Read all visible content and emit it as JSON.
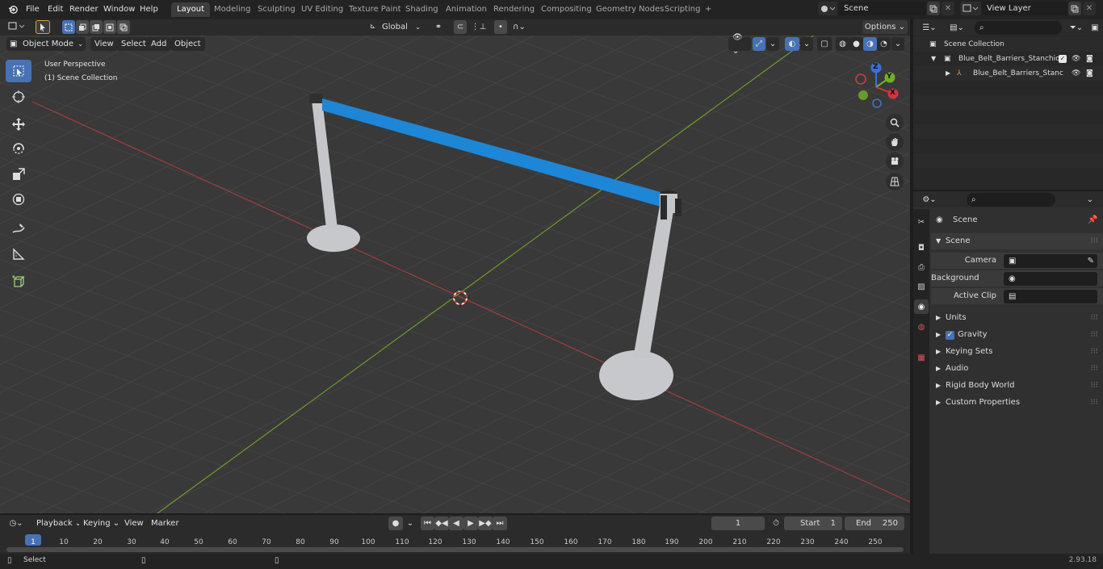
{
  "app": {
    "version": "2.93.18"
  },
  "menu": [
    "File",
    "Edit",
    "Render",
    "Window",
    "Help"
  ],
  "workspaces": [
    {
      "label": "Layout",
      "active": true
    },
    {
      "label": "Modeling",
      "active": false
    },
    {
      "label": "Sculpting",
      "active": false
    },
    {
      "label": "UV Editing",
      "active": false
    },
    {
      "label": "Texture Paint",
      "active": false
    },
    {
      "label": "Shading",
      "active": false
    },
    {
      "label": "Animation",
      "active": false
    },
    {
      "label": "Rendering",
      "active": false
    },
    {
      "label": "Compositing",
      "active": false
    },
    {
      "label": "Geometry Nodes",
      "active": false
    },
    {
      "label": "Scripting",
      "active": false
    }
  ],
  "scene_selector": {
    "value": "Scene"
  },
  "viewlayer_selector": {
    "value": "View Layer"
  },
  "tool_header": {
    "transform_orientation": "Global",
    "options_label": "Options"
  },
  "viewport_header": {
    "mode": "Object Mode",
    "menus": [
      "View",
      "Select",
      "Add",
      "Object"
    ]
  },
  "viewport": {
    "perspective_label": "User Perspective",
    "collection_label": "(1) Scene Collection",
    "gizmo": {
      "x": "X",
      "y": "Y",
      "z": "Z"
    },
    "colors": {
      "belt": "#1e86d6",
      "post": "#c4c6ca",
      "axis_x": "#b0393d",
      "axis_y": "#78a32a",
      "bg": "#393939"
    }
  },
  "outliner": {
    "items": [
      {
        "label": "Scene Collection"
      },
      {
        "label": "Blue_Belt_Barriers_Stanchion"
      },
      {
        "label": "Blue_Belt_Barriers_Stanc"
      }
    ]
  },
  "properties": {
    "context": "Scene",
    "panel": "Scene",
    "fields": [
      {
        "label": "Camera"
      },
      {
        "label": "Background Scene"
      },
      {
        "label": "Active Clip"
      }
    ],
    "subpanels": [
      "Units",
      "Gravity",
      "Keying Sets",
      "Audio",
      "Rigid Body World",
      "Custom Properties"
    ],
    "gravity_checked": true
  },
  "timeline": {
    "menus": [
      "Playback",
      "Keying",
      "View",
      "Marker"
    ],
    "current_frame": "1",
    "start_label": "Start",
    "start": "1",
    "end_label": "End",
    "end": "250",
    "ruler": [
      "1",
      "10",
      "20",
      "30",
      "40",
      "50",
      "60",
      "70",
      "80",
      "90",
      "100",
      "110",
      "120",
      "130",
      "140",
      "150",
      "160",
      "170",
      "180",
      "190",
      "200",
      "210",
      "220",
      "230",
      "240",
      "250"
    ]
  },
  "status": {
    "left": "Select"
  }
}
